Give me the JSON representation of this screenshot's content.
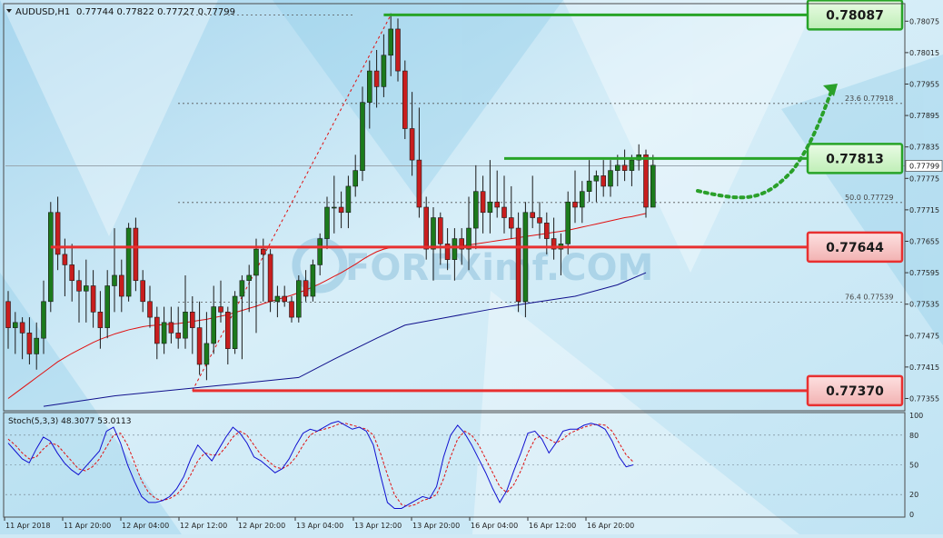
{
  "header": {
    "symbol_label": "AUDUSD,H1",
    "ohlc": "0.77744 0.77822 0.77727 0.77799"
  },
  "watermark": "FOREXimf.COM",
  "colors": {
    "bull": "#1c7a1c",
    "bear": "#c81e1e",
    "ma_fast": "#e01010",
    "ma_slow": "#10108c",
    "stoch_main": "#1010d0",
    "stoch_signal": "#e01010",
    "level_green": "#28a428",
    "level_red": "#e83030",
    "box_green_fill": "#d2f5cc",
    "box_red_fill": "#f7c6c6"
  },
  "chart_data": {
    "type": "candlestick",
    "symbol": "AUDUSD",
    "timeframe": "H1",
    "ylim": [
      0.77335,
      0.78105
    ],
    "y_ticks": [
      "0.78075",
      "0.78015",
      "0.77955",
      "0.77895",
      "0.77835",
      "0.77775",
      "0.77715",
      "0.77655",
      "0.77595",
      "0.77535",
      "0.77475",
      "0.77415",
      "0.77355"
    ],
    "current_price": "0.77799",
    "x_labels": [
      "11 Apr 2018",
      "11 Apr 20:00",
      "12 Apr 04:00",
      "12 Apr 12:00",
      "12 Apr 20:00",
      "13 Apr 04:00",
      "13 Apr 12:00",
      "13 Apr 20:00",
      "16 Apr 04:00",
      "16 Apr 12:00",
      "16 Apr 20:00"
    ],
    "candles": [
      [
        0.7754,
        0.7756,
        0.7745,
        0.7749
      ],
      [
        0.7749,
        0.7752,
        0.7744,
        0.775
      ],
      [
        0.775,
        0.7751,
        0.7743,
        0.7748
      ],
      [
        0.7748,
        0.7751,
        0.7742,
        0.7744
      ],
      [
        0.7744,
        0.775,
        0.7741,
        0.7747
      ],
      [
        0.7747,
        0.7758,
        0.7744,
        0.7754
      ],
      [
        0.7754,
        0.7773,
        0.7752,
        0.7771
      ],
      [
        0.7771,
        0.7774,
        0.776,
        0.7763
      ],
      [
        0.7763,
        0.7766,
        0.7755,
        0.7761
      ],
      [
        0.7761,
        0.7765,
        0.7754,
        0.7758
      ],
      [
        0.7758,
        0.776,
        0.775,
        0.7756
      ],
      [
        0.7756,
        0.7762,
        0.775,
        0.7757
      ],
      [
        0.7757,
        0.776,
        0.7749,
        0.7752
      ],
      [
        0.7752,
        0.7756,
        0.7745,
        0.7749
      ],
      [
        0.7749,
        0.776,
        0.7747,
        0.7757
      ],
      [
        0.7757,
        0.7768,
        0.7752,
        0.7759
      ],
      [
        0.7759,
        0.7762,
        0.7752,
        0.7755
      ],
      [
        0.7755,
        0.7769,
        0.7754,
        0.7768
      ],
      [
        0.7768,
        0.777,
        0.7756,
        0.7758
      ],
      [
        0.7758,
        0.776,
        0.7752,
        0.7754
      ],
      [
        0.7754,
        0.7757,
        0.7749,
        0.7751
      ],
      [
        0.7751,
        0.7753,
        0.7743,
        0.7746
      ],
      [
        0.7746,
        0.7753,
        0.7744,
        0.775
      ],
      [
        0.775,
        0.7753,
        0.7746,
        0.7748
      ],
      [
        0.7748,
        0.7753,
        0.7745,
        0.7747
      ],
      [
        0.7747,
        0.7759,
        0.7745,
        0.7752
      ],
      [
        0.7752,
        0.7755,
        0.7744,
        0.7749
      ],
      [
        0.7749,
        0.7754,
        0.774,
        0.7742
      ],
      [
        0.7742,
        0.7752,
        0.7739,
        0.7746
      ],
      [
        0.7746,
        0.7757,
        0.7744,
        0.7753
      ],
      [
        0.7753,
        0.7758,
        0.775,
        0.7752
      ],
      [
        0.7752,
        0.7753,
        0.7742,
        0.7745
      ],
      [
        0.7745,
        0.7756,
        0.7744,
        0.7755
      ],
      [
        0.7755,
        0.7759,
        0.7743,
        0.7758
      ],
      [
        0.7758,
        0.7761,
        0.7752,
        0.7759
      ],
      [
        0.7759,
        0.7766,
        0.7748,
        0.7764
      ],
      [
        0.7764,
        0.7766,
        0.7754,
        0.7763
      ],
      [
        0.7763,
        0.7764,
        0.7752,
        0.7754
      ],
      [
        0.7754,
        0.7757,
        0.7751,
        0.7755
      ],
      [
        0.7755,
        0.7757,
        0.7753,
        0.7754
      ],
      [
        0.7754,
        0.7755,
        0.775,
        0.7751
      ],
      [
        0.7751,
        0.7759,
        0.775,
        0.7758
      ],
      [
        0.7758,
        0.776,
        0.7754,
        0.7755
      ],
      [
        0.7755,
        0.7762,
        0.7754,
        0.7761
      ],
      [
        0.7761,
        0.7767,
        0.7759,
        0.7766
      ],
      [
        0.7766,
        0.7774,
        0.7764,
        0.7772
      ],
      [
        0.7772,
        0.7778,
        0.7767,
        0.7772
      ],
      [
        0.7772,
        0.7775,
        0.7768,
        0.7771
      ],
      [
        0.7771,
        0.7778,
        0.7768,
        0.7776
      ],
      [
        0.7776,
        0.7782,
        0.7774,
        0.7779
      ],
      [
        0.7779,
        0.7795,
        0.7777,
        0.7792
      ],
      [
        0.7792,
        0.78,
        0.7787,
        0.7798
      ],
      [
        0.7798,
        0.7802,
        0.7791,
        0.7795
      ],
      [
        0.7795,
        0.7805,
        0.7793,
        0.7801
      ],
      [
        0.7801,
        0.7809,
        0.7797,
        0.7806
      ],
      [
        0.7806,
        0.7808,
        0.7796,
        0.7798
      ],
      [
        0.7798,
        0.78,
        0.7785,
        0.7787
      ],
      [
        0.7787,
        0.7794,
        0.7778,
        0.7781
      ],
      [
        0.7781,
        0.7791,
        0.777,
        0.7772
      ],
      [
        0.7772,
        0.7774,
        0.7762,
        0.7764
      ],
      [
        0.7764,
        0.7772,
        0.7758,
        0.777
      ],
      [
        0.777,
        0.7771,
        0.7761,
        0.7765
      ],
      [
        0.7765,
        0.7768,
        0.776,
        0.7762
      ],
      [
        0.7762,
        0.7768,
        0.7758,
        0.7766
      ],
      [
        0.7766,
        0.7768,
        0.7761,
        0.7764
      ],
      [
        0.7764,
        0.7774,
        0.776,
        0.7768
      ],
      [
        0.7768,
        0.778,
        0.7764,
        0.7775
      ],
      [
        0.7775,
        0.7778,
        0.7767,
        0.7771
      ],
      [
        0.7771,
        0.7781,
        0.7767,
        0.7773
      ],
      [
        0.7773,
        0.7779,
        0.777,
        0.7772
      ],
      [
        0.7772,
        0.7778,
        0.7767,
        0.777
      ],
      [
        0.777,
        0.7776,
        0.7766,
        0.7768
      ],
      [
        0.7768,
        0.7771,
        0.7752,
        0.7754
      ],
      [
        0.7754,
        0.7773,
        0.7751,
        0.7771
      ],
      [
        0.7771,
        0.7778,
        0.7768,
        0.777
      ],
      [
        0.777,
        0.7773,
        0.7766,
        0.7769
      ],
      [
        0.7769,
        0.7771,
        0.7763,
        0.7766
      ],
      [
        0.7766,
        0.777,
        0.7762,
        0.7764
      ],
      [
        0.7764,
        0.7767,
        0.7759,
        0.7765
      ],
      [
        0.7765,
        0.7775,
        0.7763,
        0.7773
      ],
      [
        0.7773,
        0.7779,
        0.7769,
        0.7772
      ],
      [
        0.7772,
        0.7777,
        0.7769,
        0.7775
      ],
      [
        0.7775,
        0.7781,
        0.7773,
        0.7777
      ],
      [
        0.7777,
        0.7779,
        0.7773,
        0.7778
      ],
      [
        0.7778,
        0.7781,
        0.7774,
        0.7776
      ],
      [
        0.7776,
        0.7781,
        0.7774,
        0.7779
      ],
      [
        0.7779,
        0.7782,
        0.7776,
        0.778
      ],
      [
        0.778,
        0.7783,
        0.7777,
        0.7779
      ],
      [
        0.7779,
        0.7782,
        0.7776,
        0.7781
      ],
      [
        0.7781,
        0.7784,
        0.7779,
        0.7782
      ],
      [
        0.7782,
        0.7783,
        0.777,
        0.7772
      ],
      [
        0.7772,
        0.7782,
        0.7772,
        0.778
      ]
    ],
    "ma_fast": [
      0.77355,
      0.77365,
      0.77375,
      0.77385,
      0.77395,
      0.77405,
      0.77415,
      0.77425,
      0.77433,
      0.77441,
      0.77448,
      0.77455,
      0.77462,
      0.77468,
      0.77473,
      0.77478,
      0.77482,
      0.77486,
      0.77489,
      0.77492,
      0.77494,
      0.77495,
      0.77496,
      0.77497,
      0.77498,
      0.775,
      0.77502,
      0.77504,
      0.77506,
      0.77509,
      0.77512,
      0.77515,
      0.77519,
      0.77523,
      0.77527,
      0.77531,
      0.77536,
      0.7754,
      0.77544,
      0.77548,
      0.77552,
      0.77557,
      0.77562,
      0.77568,
      0.77574,
      0.77581,
      0.77588,
      0.77595,
      0.77603,
      0.77611,
      0.7762,
      0.77628,
      0.77635,
      0.7764,
      0.77643,
      0.77644,
      0.77644,
      0.77644,
      0.77644,
      0.77644,
      0.77644,
      0.77644,
      0.77644,
      0.77645,
      0.77646,
      0.77648,
      0.7765,
      0.77652,
      0.77654,
      0.77656,
      0.77658,
      0.7766,
      0.77662,
      0.77664,
      0.77666,
      0.77668,
      0.7767,
      0.77672,
      0.77674,
      0.77676,
      0.77679,
      0.77682,
      0.77685,
      0.77688,
      0.77691,
      0.77694,
      0.77697,
      0.777,
      0.77702,
      0.77705,
      0.77708
    ],
    "ma_slow_points": [
      [
        5,
        0.7734
      ],
      [
        15,
        0.7736
      ],
      [
        30,
        0.7738
      ],
      [
        41,
        0.77395
      ],
      [
        46,
        0.7743
      ],
      [
        52,
        0.7747
      ],
      [
        56,
        0.77495
      ],
      [
        62,
        0.7751
      ],
      [
        68,
        0.77525
      ],
      [
        74,
        0.77538
      ],
      [
        80,
        0.7755
      ],
      [
        86,
        0.77572
      ],
      [
        90,
        0.77595
      ]
    ],
    "resistance_segment": {
      "from_candle": 34,
      "to_candle": 90,
      "label_0": "50.0",
      "value_0": "0.77729"
    },
    "fibonacci": [
      {
        "level": "23.6",
        "price": "0.77918"
      },
      {
        "level": "50.0",
        "price": "0.77729"
      },
      {
        "level": "76.4",
        "price": "0.77539"
      }
    ],
    "levels": [
      {
        "price": "0.78087",
        "role": "target",
        "kind": "green",
        "from_candle": 53
      },
      {
        "price": "0.77813",
        "role": "resistance",
        "kind": "green",
        "from_candle": 70
      },
      {
        "price": "0.77644",
        "role": "support",
        "kind": "red",
        "from_candle": 6
      },
      {
        "price": "0.77370",
        "role": "support",
        "kind": "red",
        "from_candle": 26
      }
    ],
    "fib_trend": {
      "from": [
        26,
        0.7737
      ],
      "to": [
        54,
        0.78087
      ]
    },
    "stochastic": {
      "label": "Stoch(5,3,3) 48.3077 53.0113",
      "ylim": [
        0,
        100
      ],
      "ticks": [
        "100",
        "80",
        "50",
        "20",
        "0"
      ],
      "main": [
        72,
        64,
        56,
        52,
        66,
        78,
        74,
        62,
        52,
        45,
        40,
        48,
        56,
        64,
        84,
        88,
        72,
        50,
        33,
        18,
        12,
        12,
        14,
        18,
        26,
        38,
        56,
        70,
        62,
        54,
        66,
        78,
        88,
        82,
        72,
        58,
        54,
        48,
        42,
        46,
        56,
        70,
        82,
        86,
        84,
        88,
        92,
        94,
        90,
        86,
        88,
        84,
        70,
        40,
        12,
        6,
        6,
        10,
        14,
        18,
        16,
        28,
        58,
        80,
        90,
        82,
        70,
        56,
        42,
        26,
        12,
        24,
        44,
        62,
        82,
        84,
        76,
        62,
        72,
        84,
        86,
        86,
        90,
        92,
        90,
        86,
        74,
        58,
        48,
        50
      ],
      "signal": [
        76,
        70,
        62,
        56,
        58,
        66,
        72,
        70,
        62,
        54,
        46,
        44,
        48,
        56,
        68,
        80,
        82,
        70,
        52,
        34,
        22,
        16,
        14,
        16,
        20,
        28,
        40,
        54,
        62,
        60,
        60,
        68,
        78,
        84,
        80,
        70,
        60,
        54,
        48,
        46,
        50,
        58,
        70,
        80,
        84,
        86,
        88,
        91,
        92,
        90,
        88,
        86,
        80,
        62,
        40,
        20,
        10,
        8,
        10,
        14,
        16,
        20,
        36,
        58,
        76,
        84,
        80,
        70,
        56,
        42,
        28,
        22,
        30,
        44,
        62,
        76,
        80,
        76,
        72,
        76,
        82,
        85,
        88,
        90,
        91,
        90,
        84,
        72,
        60,
        53
      ]
    }
  }
}
